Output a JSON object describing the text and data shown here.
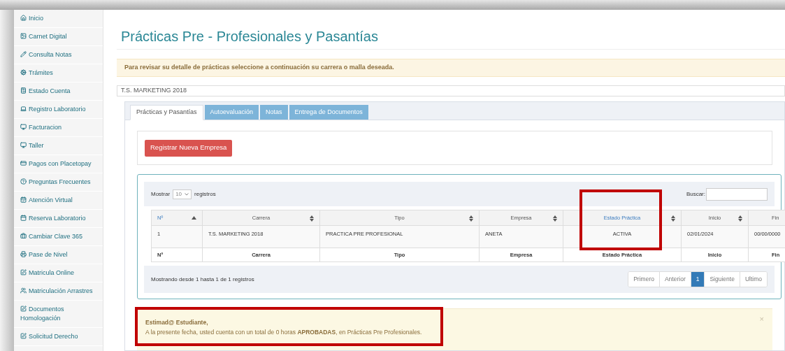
{
  "sidebar": {
    "items": [
      {
        "label": "Inicio"
      },
      {
        "label": "Carnet Digital"
      },
      {
        "label": "Consulta Notas"
      },
      {
        "label": "Trámites"
      },
      {
        "label": "Estado Cuenta"
      },
      {
        "label": "Registro Laboratorio"
      },
      {
        "label": "Facturacion"
      },
      {
        "label": "Taller"
      },
      {
        "label": "Pagos con Placetopay"
      },
      {
        "label": "Preguntas Frecuentes"
      },
      {
        "label": "Atención Virtual"
      },
      {
        "label": "Reserva Laboratorio"
      },
      {
        "label": "Cambiar Clave 365"
      },
      {
        "label": "Pase de Nivel"
      },
      {
        "label": "Matricula Online"
      },
      {
        "label": "Matriculación Arrastres"
      },
      {
        "label": "Documentos Homologación"
      },
      {
        "label": "Solicitud Derecho"
      }
    ]
  },
  "page_title": "Prácticas Pre - Profesionales y Pasantías",
  "info_alert": "Para revisar su detalle de prácticas seleccione a continuación su carrera o malla deseada.",
  "career_select": {
    "value": "T.S. MARKETING 2018"
  },
  "tabs": [
    {
      "label": "Prácticas y Pasantías",
      "selected": true
    },
    {
      "label": "Autoevaluación",
      "selected": false
    },
    {
      "label": "Notas",
      "selected": false
    },
    {
      "label": "Entrega de Documentos",
      "selected": false
    }
  ],
  "new_company_button": "Registrar Nueva Empresa",
  "table": {
    "length_label_before": "Mostrar",
    "length_value": "10",
    "length_label_after": "registros",
    "search_label": "Buscar:",
    "columns": [
      {
        "label": "Nº",
        "sorted": true,
        "emphasized": true,
        "highlighted": false
      },
      {
        "label": "Carrera",
        "sorted": false,
        "emphasized": false,
        "highlighted": false
      },
      {
        "label": "Tipo",
        "sorted": false,
        "emphasized": false,
        "highlighted": false
      },
      {
        "label": "Empresa",
        "sorted": false,
        "emphasized": false,
        "highlighted": false
      },
      {
        "label": "Estado Práctica",
        "sorted": false,
        "emphasized": true,
        "highlighted": true
      },
      {
        "label": "Inicio",
        "sorted": false,
        "emphasized": false,
        "highlighted": false
      },
      {
        "label": "Fin",
        "emphasized": false,
        "highlighted": false
      }
    ],
    "rows": [
      [
        "1",
        "T.S. MARKETING 2018",
        "PRACTICA PRE PROFESIONAL",
        "ANETA",
        "ACTIVA",
        "02/01/2024",
        "00/00/0000"
      ]
    ],
    "footer": [
      "Nº",
      "Carrera",
      "Tipo",
      "Empresa",
      "Estado Práctica",
      "Inicio",
      "Fin"
    ],
    "info": "Mostrando desde 1 hasta 1 de 1 registros",
    "pagination": [
      {
        "label": "Primero",
        "selected": false
      },
      {
        "label": "Anterior",
        "selected": false
      },
      {
        "label": "1",
        "selected": true
      },
      {
        "label": "Siguiente",
        "selected": false
      },
      {
        "label": "Ultimo",
        "selected": false
      }
    ]
  },
  "notice": {
    "highlighted": true,
    "title": "Estimad@ Estudiante,",
    "text": "A la presente fecha, usted cuenta con un total de 0 horas **APROBADAS**, en Prácticas Pre Profesionales.",
    "close": "×"
  }
}
